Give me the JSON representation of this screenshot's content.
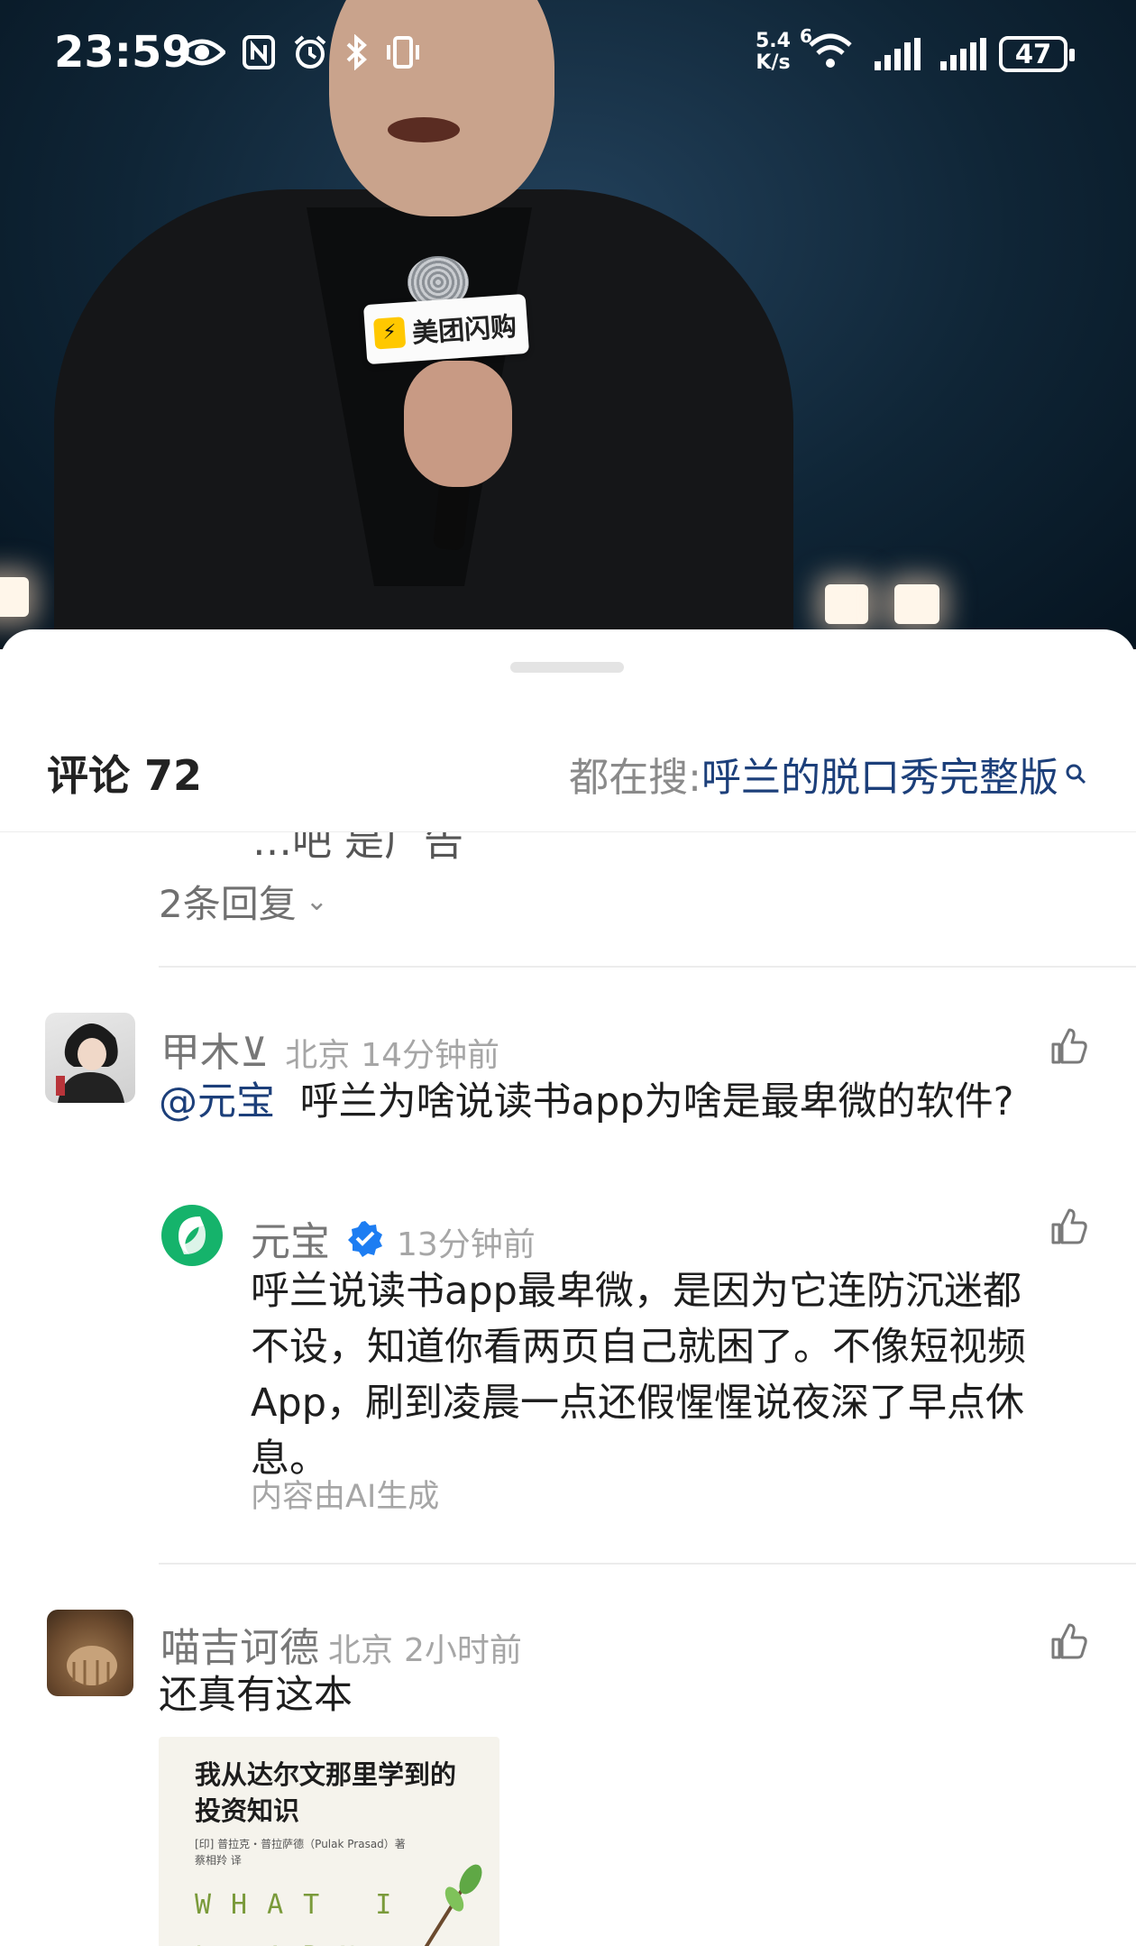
{
  "status_bar": {
    "time": "23:59",
    "net_speed_value": "5.4",
    "net_speed_unit": "K/s",
    "wifi_badge": "6",
    "battery": "47",
    "icons": [
      "eye-icon",
      "nfc-icon",
      "alarm-icon",
      "bluetooth-icon",
      "vibrate-icon",
      "wifi-icon",
      "signal-icon",
      "battery-icon"
    ]
  },
  "video": {
    "mic_flag_text": "美团闪购"
  },
  "sheet": {
    "title": "评论 72",
    "search_prefix": "都在搜:",
    "search_term": "呼兰的脱口秀完整版",
    "clipped_text": "…吧 是广告",
    "reply_toggle": "2条回复",
    "comments": [
      {
        "username": "甲木⊻",
        "location": "北京",
        "time": "14分钟前",
        "mention": "@元宝",
        "text": "呼兰为啥说读书app为啥是最卑微的软件?",
        "reply": {
          "username": "元宝",
          "time": "13分钟前",
          "line1": "呼兰说读书app最卑微，是因为它连防沉迷都",
          "line2": "不设，知道你看两页自己就困了。不像短视频",
          "line3": "App，刷到凌晨一点还假惺惺说夜深了早点休",
          "line4": "息。",
          "ai_note": "内容由AI生成"
        }
      },
      {
        "username": "喵吉诃德",
        "location": "北京",
        "time": "2小时前",
        "text": "还真有这本",
        "image": {
          "book_title_line1": "我从达尔文那里学到的",
          "book_title_line2": "投资知识",
          "book_author": "[印] 普拉克・普拉萨德（Pulak Prasad）著",
          "book_translator": "蔡相羚  译",
          "book_english_line1": "WHAT I",
          "book_english_line2": "LEARNED"
        }
      }
    ]
  },
  "colors": {
    "accent_link": "#1c3f7a",
    "verified_blue": "#1d7df2",
    "yuanbao_green": "#15b36b"
  }
}
